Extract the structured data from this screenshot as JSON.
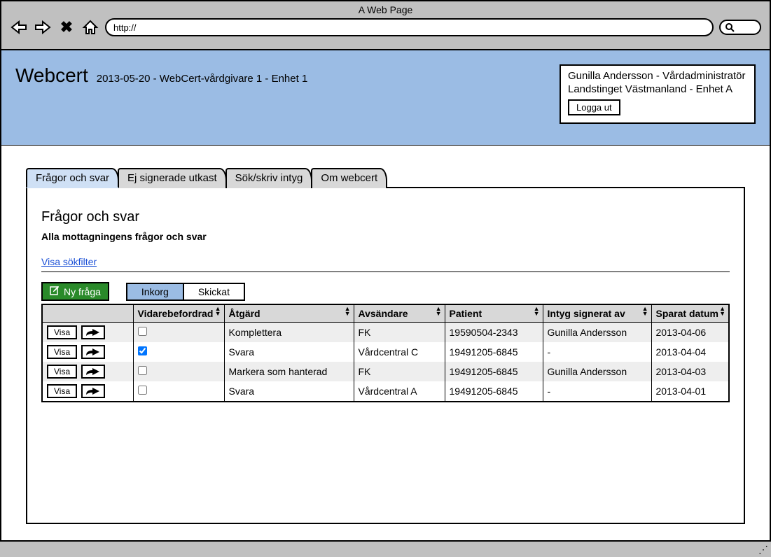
{
  "browser": {
    "title": "A Web Page",
    "url": "http://"
  },
  "header": {
    "app_name": "Webcert",
    "subtitle": "2013-05-20 - WebCert-vårdgivare 1 - Enhet 1",
    "user_line1": "Gunilla Andersson - Vårdadministratör",
    "user_line2": "Landstinget Västmanland - Enhet A",
    "logout_label": "Logga ut"
  },
  "tabs": [
    {
      "label": "Frågor och svar",
      "active": true
    },
    {
      "label": "Ej signerade utkast",
      "active": false
    },
    {
      "label": "Sök/skriv intyg",
      "active": false
    },
    {
      "label": "Om webcert",
      "active": false
    }
  ],
  "panel": {
    "title": "Frågor och svar",
    "subtitle": "Alla mottagningens frågor och svar",
    "filter_link": "Visa sökfilter",
    "new_question_label": "Ny fråga",
    "toggle": {
      "inkorg": "Inkorg",
      "skickat": "Skickat"
    }
  },
  "table": {
    "columns": [
      "",
      "Vidarebefordrad",
      "Åtgärd",
      "Avsändare",
      "Patient",
      "Intyg signerat av",
      "Sparat datum"
    ],
    "row_action_label": "Visa",
    "rows": [
      {
        "forwarded": false,
        "action": "Komplettera",
        "sender": "FK",
        "patient": "19590504-2343",
        "signed_by": "Gunilla Andersson",
        "saved": "2013-04-06"
      },
      {
        "forwarded": true,
        "action": "Svara",
        "sender": "Vårdcentral C",
        "patient": "19491205-6845",
        "signed_by": "-",
        "saved": "2013-04-04"
      },
      {
        "forwarded": false,
        "action": "Markera som hanterad",
        "sender": "FK",
        "patient": "19491205-6845",
        "signed_by": "Gunilla Andersson",
        "saved": "2013-04-03"
      },
      {
        "forwarded": false,
        "action": "Svara",
        "sender": "Vårdcentral A",
        "patient": "19491205-6845",
        "signed_by": "-",
        "saved": "2013-04-01"
      }
    ]
  }
}
